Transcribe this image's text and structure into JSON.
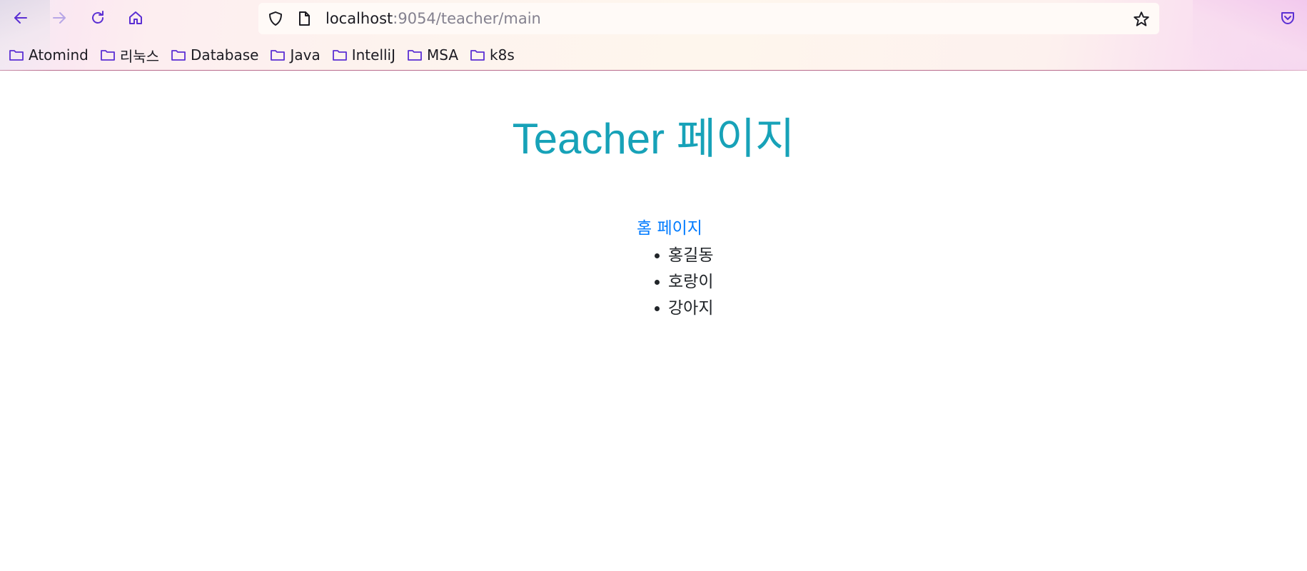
{
  "browser": {
    "url_host": "localhost",
    "url_path": ":9054/teacher/main",
    "nav": {
      "back_icon": "arrow-left-icon",
      "forward_icon": "arrow-right-icon",
      "reload_icon": "reload-icon",
      "home_icon": "home-icon"
    },
    "bookmarks": [
      {
        "label": "Atomind",
        "icon": "folder-icon"
      },
      {
        "label": "리눅스",
        "icon": "folder-icon"
      },
      {
        "label": "Database",
        "icon": "folder-icon"
      },
      {
        "label": "Java",
        "icon": "folder-icon"
      },
      {
        "label": "IntelliJ",
        "icon": "folder-icon"
      },
      {
        "label": "MSA",
        "icon": "folder-icon"
      },
      {
        "label": "k8s",
        "icon": "folder-icon"
      }
    ],
    "accent_color": "#5b2fd3"
  },
  "page": {
    "title": "Teacher 페이지",
    "title_color": "#17a2b8",
    "home_link": "홈 페이지",
    "link_color": "#007bff",
    "teachers": [
      "홍길동",
      "호랑이",
      "강아지"
    ]
  }
}
